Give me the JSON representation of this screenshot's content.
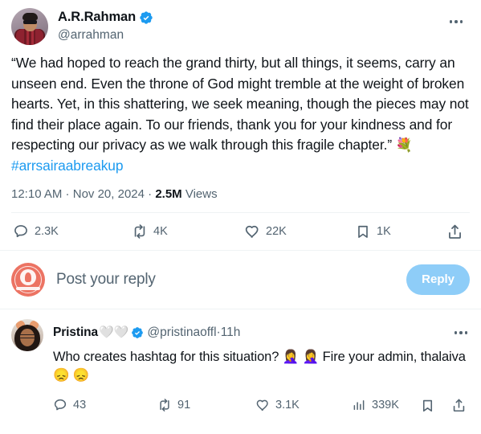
{
  "main_post": {
    "author_name": "A.R.Rahman",
    "handle": "@arrahman",
    "verified": true,
    "verified_color": "#1d9bf0",
    "avatar_icon": "avatar-arrahman",
    "more_icon": "more-horizontal-icon",
    "text_part1": "“We had hoped to reach the grand thirty, but all things, it seems, carry an unseen end. Even the throne of God might tremble at the weight of broken hearts. Yet, in this shattering, we seek meaning, though the pieces may not find their place again. To our friends, thank you for your kindness and for respecting our privacy as we walk through this fragile chapter.” ",
    "text_emoji": "💐",
    "hashtag": "#arrsairaabreakup",
    "hashtag_color": "#1d9bf0",
    "timestamp_time": "12:10 AM",
    "timestamp_date": "Nov 20, 2024",
    "views_count": "2.5M",
    "views_label": "Views",
    "separator": " · ",
    "actions": {
      "reply_count": "2.3K",
      "retweet_count": "4K",
      "like_count": "22K",
      "bookmark_count": "1K",
      "share_icon": "share-icon",
      "reply_icon": "comment-icon",
      "retweet_icon": "retweet-icon",
      "like_icon": "heart-icon",
      "bookmark_icon": "bookmark-icon"
    }
  },
  "composer": {
    "avatar_icon": "avatar-current-user",
    "placeholder": "Post your reply",
    "reply_button_label": "Reply",
    "reply_button_color": "#8ecdf8"
  },
  "reply": {
    "author_name": "Pristina",
    "name_emojis": "🤍🤍",
    "handle": "@pristinaoffl",
    "verified": true,
    "time_ago": "11h",
    "separator": " · ",
    "avatar_icon": "avatar-pristina",
    "more_icon": "more-horizontal-icon",
    "text": "Who creates hashtag for this situation? 🤦‍♀️ 🤦‍♀️ Fire your admin, thalaiva 😞 😞",
    "actions": {
      "reply_count": "43",
      "retweet_count": "91",
      "like_count": "3.1K",
      "views_count": "339K",
      "views_icon": "analytics-icon",
      "bookmark_icon": "bookmark-icon",
      "share_icon": "share-icon",
      "reply_icon": "comment-icon",
      "retweet_icon": "retweet-icon",
      "like_icon": "heart-icon"
    }
  },
  "theme": {
    "text_primary": "#0f1419",
    "text_secondary": "#536471",
    "link": "#1d9bf0",
    "divider": "#eff3f4",
    "background": "#ffffff"
  }
}
